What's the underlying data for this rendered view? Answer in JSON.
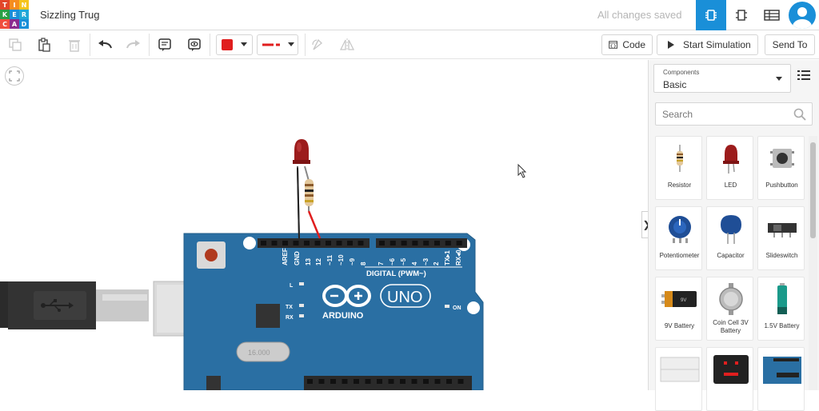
{
  "app": {
    "logo_letters": [
      "T",
      "I",
      "N",
      "K",
      "E",
      "R",
      "C",
      "A",
      "D"
    ],
    "logo_colors": [
      "#e2462a",
      "#f68d1e",
      "#f6c41d",
      "#2a9f45",
      "#1a8fd8",
      "#21a7d7",
      "#ef4d3e",
      "#8b2b8f",
      "#1a8fd8"
    ],
    "design_title": "Sizzling Trug",
    "save_status": "All changes saved"
  },
  "toolbar": {
    "code_label": "Code",
    "start_sim_label": "Start Simulation",
    "send_to_label": "Send To",
    "color_swatch": "#e01e1e",
    "wire_color": "#e01e1e"
  },
  "panel": {
    "components_caption": "Components",
    "components_value": "Basic",
    "search_placeholder": "Search",
    "items": [
      {
        "label": "Resistor",
        "icon": "resistor-icon"
      },
      {
        "label": "LED",
        "icon": "led-icon"
      },
      {
        "label": "Pushbutton",
        "icon": "pushbutton-icon"
      },
      {
        "label": "Potentiometer",
        "icon": "potentiometer-icon"
      },
      {
        "label": "Capacitor",
        "icon": "capacitor-icon"
      },
      {
        "label": "Slideswitch",
        "icon": "slideswitch-icon"
      },
      {
        "label": "9V Battery",
        "icon": "battery-9v-icon"
      },
      {
        "label": "Coin Cell 3V Battery",
        "icon": "coin-cell-icon"
      },
      {
        "label": "1.5V Battery",
        "icon": "battery-aa-icon"
      },
      {
        "label": "",
        "icon": "breadboard-icon"
      },
      {
        "label": "",
        "icon": "microbit-icon"
      },
      {
        "label": "",
        "icon": "arduino-icon"
      }
    ]
  },
  "board": {
    "header_pins": [
      "AREF",
      "GND",
      "13",
      "12",
      "~11",
      "~10",
      "~9",
      "8",
      "7",
      "~6",
      "~5",
      "4",
      "~3",
      "2",
      "TX▸1",
      "RX◂0"
    ],
    "digital_label": "DIGITAL (PWM~)",
    "brand": "ARDUINO",
    "model": "UNO",
    "led_l": "L",
    "led_tx": "TX",
    "led_rx": "RX",
    "led_on": "ON",
    "crystal": "16.000"
  }
}
